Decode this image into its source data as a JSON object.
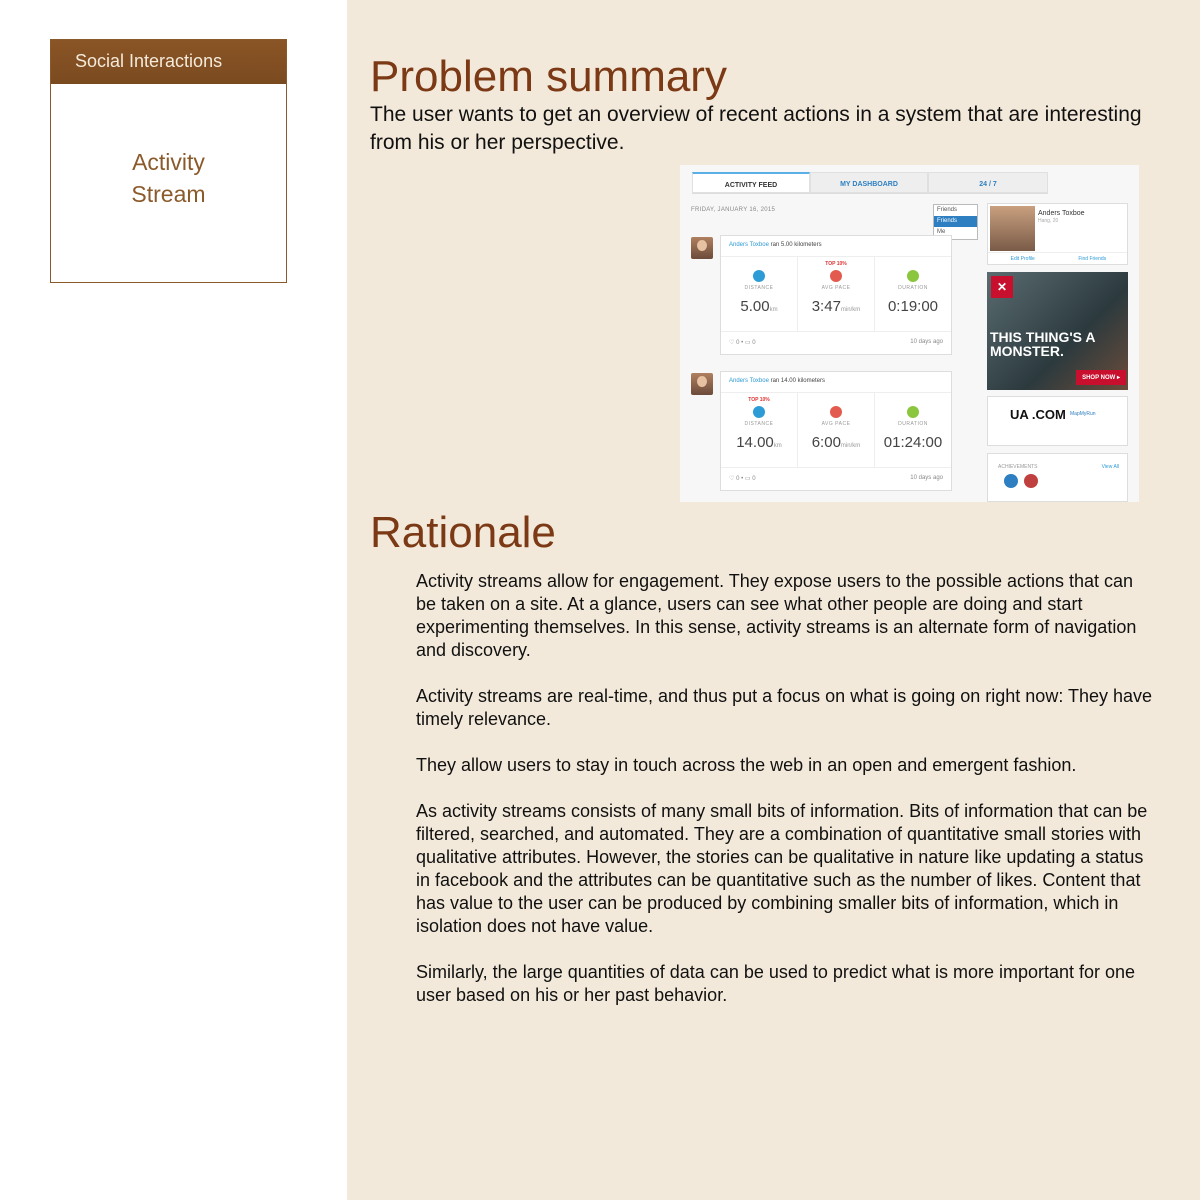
{
  "sidebar": {
    "category": "Social Interactions",
    "pattern_title_line1": "Activity",
    "pattern_title_line2": "Stream"
  },
  "problem": {
    "heading": "Problem summary",
    "text": "The user wants to get an overview of recent actions in a system that are interesting from his or her perspective."
  },
  "screenshot": {
    "tabs": [
      "ACTIVITY FEED",
      "MY DASHBOARD",
      "24 / 7"
    ],
    "date": "FRIDAY, JANUARY 16, 2015",
    "dropdown": {
      "value": "Friends",
      "options": [
        "Friends",
        "Me"
      ]
    },
    "activities": [
      {
        "name": "Anders Toxboe",
        "action": "ran 5.00 kilometers",
        "distance": "5.00",
        "distance_unit": "km",
        "pace": "3:47",
        "pace_unit": "min/km",
        "duration": "0:19:00",
        "likes": "0",
        "comments": "0",
        "ago": "10 days ago",
        "top_badge": "TOP 10%"
      },
      {
        "name": "Anders Toxboe",
        "action": "ran 14.00 kilometers",
        "distance": "14.00",
        "distance_unit": "km",
        "pace": "6:00",
        "pace_unit": "min/km",
        "duration": "01:24:00",
        "likes": "0",
        "comments": "0",
        "ago": "10 days ago",
        "top_badge": "TOP 10%"
      }
    ],
    "labels": {
      "distance": "DISTANCE",
      "avg_pace": "AVG PACE",
      "duration": "DURATION"
    },
    "profile": {
      "name": "Anders Toxboe",
      "location": "Hang, 20",
      "edit": "Edit Profile",
      "find": "Find Friends"
    },
    "ad": {
      "headline": "THIS THING'S A MONSTER.",
      "cta": "SHOP NOW ▸"
    },
    "ua": {
      "logo": "UA .COM",
      "mmr": "MapMyRun"
    },
    "achievements": {
      "title": "ACHIEVEMENTS",
      "view_all": "View All"
    }
  },
  "rationale": {
    "heading": "Rationale",
    "paragraphs": [
      "Activity streams allow for engagement. They expose users to the possible actions that can be taken on a site. At a glance, users can see what other people are doing and start experimenting themselves. In this sense, activity streams is an alternate form of navigation and discovery.",
      "Activity streams are real-time, and thus put a focus on what is going on right now: They have timely relevance.",
      "They allow users to stay in touch across the web in an open and emergent fashion.",
      "As activity streams consists of many small bits of information. Bits of information that can be filtered, searched, and automated. They are a combination of quantitative small stories with qualitative attributes. However, the stories can be qualitative in nature like updating a status in facebook and the attributes can be quantitative such as the number of likes. Content that has value to the user can be produced by combining smaller bits of information, which in isolation does not have value.",
      "Similarly, the large quantities of data can be used to predict what is more important for one user based on his or her past behavior."
    ]
  },
  "colors": {
    "accent_brown": "#7b3a15",
    "header_brown": "#8a5526",
    "beige_bg": "#f3e9da"
  }
}
